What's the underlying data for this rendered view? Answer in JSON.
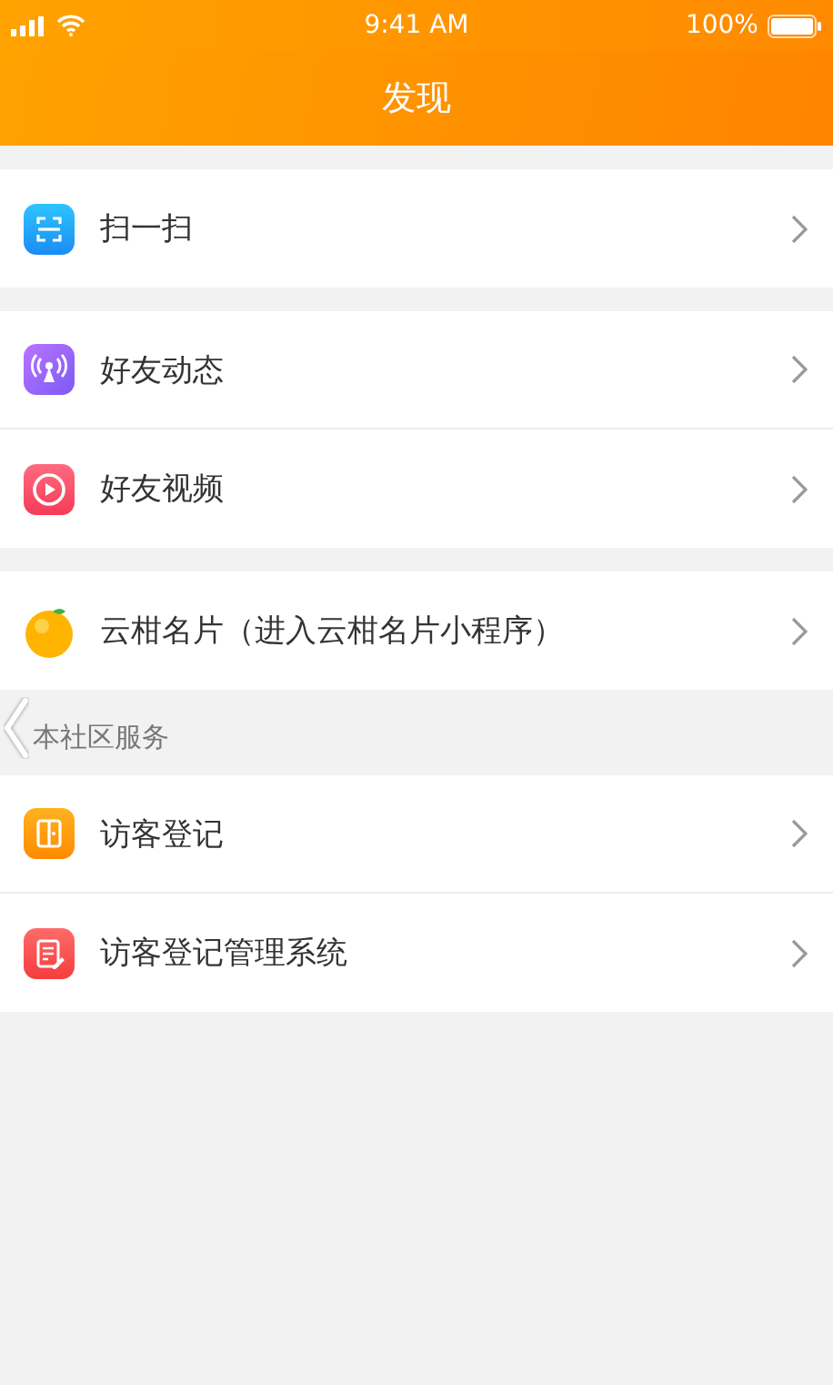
{
  "status_bar": {
    "time": "9:41 AM",
    "battery": "100%"
  },
  "nav": {
    "title": "发现"
  },
  "groups": [
    {
      "items": [
        {
          "label": "扫一扫"
        }
      ]
    },
    {
      "items": [
        {
          "label": "好友动态"
        },
        {
          "label": "好友视频"
        }
      ]
    },
    {
      "items": [
        {
          "label": "云柑名片（进入云柑名片小程序）"
        }
      ]
    },
    {
      "section_title": "本社区服务",
      "items": [
        {
          "label": "访客登记"
        },
        {
          "label": "访客登记管理系统"
        }
      ]
    }
  ]
}
